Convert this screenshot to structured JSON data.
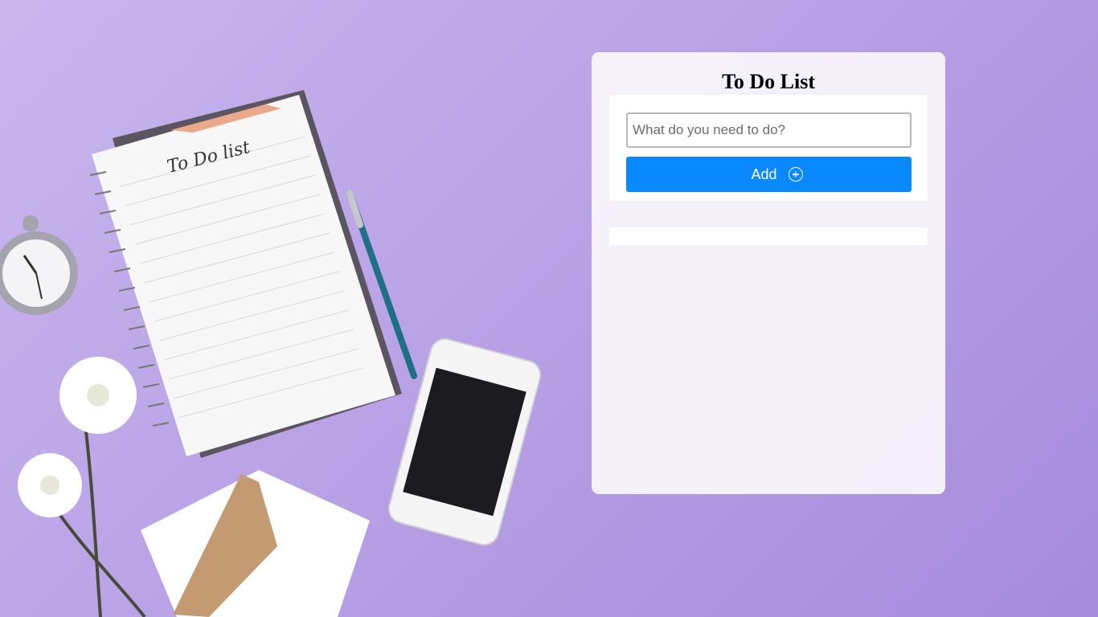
{
  "app": {
    "title": "To Do List"
  },
  "form": {
    "input_value": "",
    "input_placeholder": "What do you need to do?",
    "add_label": "Add",
    "add_icon": "plus-circle-icon"
  },
  "tasks": [],
  "colors": {
    "accent": "#0a89ff",
    "background": "#b9a2e6",
    "card": "#faf8fd"
  }
}
